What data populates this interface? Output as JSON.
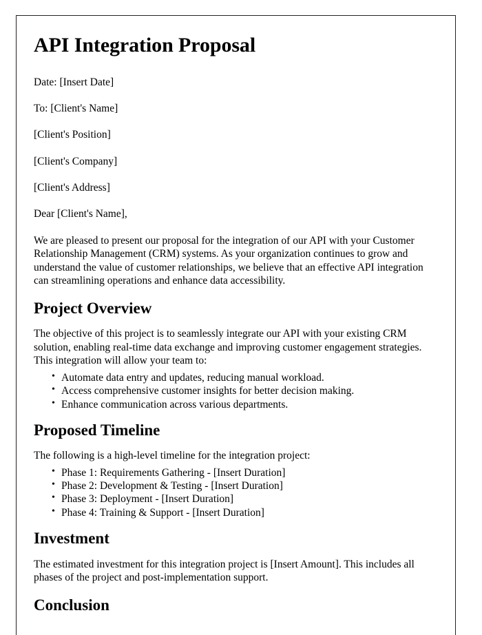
{
  "document": {
    "title": "API Integration Proposal",
    "header_block": [
      "Date: [Insert Date]",
      "To: [Client's Name]",
      "[Client's Position]",
      "[Client's Company]",
      "[Client's Address]"
    ],
    "salutation": "Dear [Client's Name],",
    "opening_paragraph": "We are pleased to present our proposal for the integration of our API with your Customer Relationship Management (CRM) systems. As your organization continues to grow and understand the value of customer relationships, we believe that an effective API integration can streamlining operations and enhance data accessibility.",
    "sections": [
      {
        "heading": "Project Overview",
        "intro": "The objective of this project is to seamlessly integrate our API with your existing CRM solution, enabling real-time data exchange and improving customer engagement strategies. This integration will allow your team to:",
        "bullets": [
          "Automate data entry and updates, reducing manual workload.",
          "Access comprehensive customer insights for better decision making.",
          "Enhance communication across various departments."
        ]
      },
      {
        "heading": "Proposed Timeline",
        "intro": "The following is a high-level timeline for the integration project:",
        "bullets": [
          "Phase 1: Requirements Gathering - [Insert Duration]",
          "Phase 2: Development & Testing - [Insert Duration]",
          "Phase 3: Deployment - [Insert Duration]",
          "Phase 4: Training & Support - [Insert Duration]"
        ]
      },
      {
        "heading": "Investment",
        "intro": "The estimated investment for this integration project is [Insert Amount]. This includes all phases of the project and post-implementation support.",
        "bullets": []
      },
      {
        "heading": "Conclusion",
        "intro": "",
        "bullets": []
      }
    ]
  }
}
